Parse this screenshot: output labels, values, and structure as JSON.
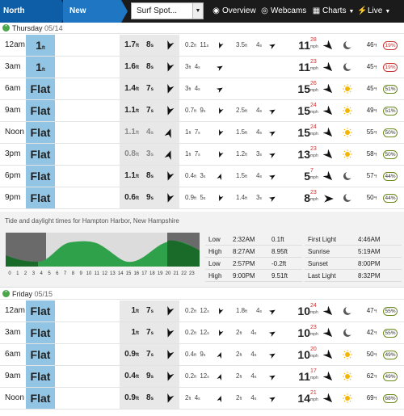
{
  "nav": {
    "region": "North America",
    "subregion": "New England",
    "spot_placeholder": "Surf Spot...",
    "links": [
      {
        "label": "Overview",
        "icon": "globe-icon"
      },
      {
        "label": "Webcams",
        "icon": "webcam-icon"
      },
      {
        "label": "Charts",
        "icon": "grid-icon"
      },
      {
        "label": "Live",
        "icon": "bolt-icon"
      }
    ]
  },
  "days": [
    {
      "name": "Thursday",
      "date": "05/14",
      "rows": [
        {
          "time": "12am",
          "surf": "1",
          "surf_unit": "ft",
          "flat": false,
          "sw1": "1.7",
          "sw1p": "8",
          "sw1dir": 200,
          "sw2": "0.2",
          "sw2p": "11",
          "sw2dir": 200,
          "sw3": "3.5",
          "sw3p": "4",
          "sw3dir": 60,
          "wind": "11",
          "gust": "28",
          "winddir": 135,
          "weather": "moon",
          "temp": "46",
          "tide": "19%",
          "tide_color": "red"
        },
        {
          "time": "3am",
          "surf": "1",
          "surf_unit": "ft",
          "flat": false,
          "sw1": "1.6",
          "sw1p": "8",
          "sw1dir": 200,
          "sw2": "3",
          "sw2p": "4",
          "sw2dir": 60,
          "sw3": "",
          "sw3p": "",
          "sw3dir": null,
          "wind": "11",
          "gust": "23",
          "winddir": 135,
          "weather": "moon",
          "temp": "45",
          "tide": "19%",
          "tide_color": "red"
        },
        {
          "time": "6am",
          "surf": "Flat",
          "surf_unit": "",
          "flat": true,
          "sw1": "1.4",
          "sw1p": "7",
          "sw1dir": 200,
          "sw2": "3",
          "sw2p": "4",
          "sw2dir": 60,
          "sw3": "",
          "sw3p": "",
          "sw3dir": null,
          "wind": "15",
          "gust": "26",
          "winddir": 135,
          "weather": "sun",
          "temp": "45",
          "tide": "51%",
          "tide_color": "green"
        },
        {
          "time": "9am",
          "surf": "Flat",
          "surf_unit": "",
          "flat": true,
          "sw1": "1.1",
          "sw1p": "7",
          "sw1dir": 200,
          "sw2": "0.7",
          "sw2p": "9",
          "sw2dir": 200,
          "sw3": "2.5",
          "sw3p": "4",
          "sw3dir": 60,
          "wind": "15",
          "gust": "24",
          "winddir": 135,
          "weather": "sun",
          "temp": "49",
          "tide": "51%",
          "tide_color": "green"
        },
        {
          "time": "Noon",
          "surf": "Flat",
          "surf_unit": "",
          "flat": true,
          "sw1": "1.1",
          "sw1p": "4",
          "sw1dir": 20,
          "sw2": "1",
          "sw2p": "7",
          "sw2dir": 200,
          "sw3": "1.5",
          "sw3p": "4",
          "sw3dir": 60,
          "wind": "15",
          "gust": "24",
          "winddir": 135,
          "weather": "sun",
          "temp": "55",
          "tide": "50%",
          "tide_color": "green",
          "grey": true
        },
        {
          "time": "3pm",
          "surf": "Flat",
          "surf_unit": "",
          "flat": true,
          "sw1": "0.8",
          "sw1p": "3",
          "sw1dir": 20,
          "sw2": "1",
          "sw2p": "7",
          "sw2dir": 200,
          "sw3": "1.2",
          "sw3p": "3",
          "sw3dir": 60,
          "wind": "13",
          "gust": "23",
          "winddir": 135,
          "weather": "sun",
          "temp": "58",
          "tide": "50%",
          "tide_color": "green",
          "grey": true
        },
        {
          "time": "6pm",
          "surf": "Flat",
          "surf_unit": "",
          "flat": true,
          "sw1": "1.1",
          "sw1p": "8",
          "sw1dir": 200,
          "sw2": "0.4",
          "sw2p": "3",
          "sw2dir": 20,
          "sw3": "1.5",
          "sw3p": "4",
          "sw3dir": 60,
          "wind": "5",
          "gust": "7",
          "winddir": 135,
          "weather": "moon",
          "temp": "57",
          "tide": "44%",
          "tide_color": "green"
        },
        {
          "time": "9pm",
          "surf": "Flat",
          "surf_unit": "",
          "flat": true,
          "sw1": "0.6",
          "sw1p": "9",
          "sw1dir": 200,
          "sw2": "0.9",
          "sw2p": "5",
          "sw2dir": 200,
          "sw3": "1.4",
          "sw3p": "3",
          "sw3dir": 60,
          "wind": "8",
          "gust": "23",
          "winddir": 90,
          "weather": "moon",
          "temp": "50",
          "tide": "44%",
          "tide_color": "green"
        }
      ]
    },
    {
      "name": "Friday",
      "date": "05/15",
      "rows": [
        {
          "time": "12am",
          "surf": "Flat",
          "surf_unit": "",
          "flat": true,
          "sw1": "1",
          "sw1p": "7",
          "sw1dir": 200,
          "sw2": "0.2",
          "sw2p": "12",
          "sw2dir": 200,
          "sw3": "1.8",
          "sw3p": "4",
          "sw3dir": 60,
          "wind": "10",
          "gust": "24",
          "winddir": 135,
          "weather": "moon",
          "temp": "47",
          "tide": "55%",
          "tide_color": "green"
        },
        {
          "time": "3am",
          "surf": "Flat",
          "surf_unit": "",
          "flat": true,
          "sw1": "1",
          "sw1p": "7",
          "sw1dir": 200,
          "sw2": "0.2",
          "sw2p": "12",
          "sw2dir": 200,
          "sw3": "2",
          "sw3p": "4",
          "sw3dir": 60,
          "wind": "10",
          "gust": "23",
          "winddir": 135,
          "weather": "moon",
          "temp": "42",
          "tide": "55%",
          "tide_color": "green"
        },
        {
          "time": "6am",
          "surf": "Flat",
          "surf_unit": "",
          "flat": true,
          "sw1": "0.9",
          "sw1p": "7",
          "sw1dir": 200,
          "sw2": "0.4",
          "sw2p": "9",
          "sw2dir": 20,
          "sw3": "2",
          "sw3p": "4",
          "sw3dir": 60,
          "wind": "10",
          "gust": "20",
          "winddir": 135,
          "weather": "sun",
          "temp": "50",
          "tide": "49%",
          "tide_color": "green"
        },
        {
          "time": "9am",
          "surf": "Flat",
          "surf_unit": "",
          "flat": true,
          "sw1": "0.4",
          "sw1p": "9",
          "sw1dir": 200,
          "sw2": "0.2",
          "sw2p": "12",
          "sw2dir": 20,
          "sw3": "2",
          "sw3p": "4",
          "sw3dir": 60,
          "wind": "11",
          "gust": "17",
          "winddir": 135,
          "weather": "sun",
          "temp": "62",
          "tide": "49%",
          "tide_color": "green"
        },
        {
          "time": "Noon",
          "surf": "Flat",
          "surf_unit": "",
          "flat": true,
          "sw1": "0.9",
          "sw1p": "8",
          "sw1dir": 200,
          "sw2": "2",
          "sw2p": "4",
          "sw2dir": 20,
          "sw3": "2",
          "sw3p": "4",
          "sw3dir": 60,
          "wind": "14",
          "gust": "21",
          "winddir": 135,
          "weather": "sun",
          "temp": "69",
          "tide": "68%",
          "tide_color": "green"
        }
      ]
    }
  ],
  "tides": {
    "title": "Tide and daylight times for Hampton Harbor, New Hampshire",
    "hours": [
      "0",
      "1",
      "2",
      "3",
      "4",
      "5",
      "6",
      "7",
      "8",
      "9",
      "10",
      "11",
      "12",
      "13",
      "14",
      "15",
      "16",
      "17",
      "18",
      "19",
      "20",
      "21",
      "22",
      "23"
    ],
    "table": [
      {
        "type": "Low",
        "time": "2:32AM",
        "height": "0.1ft"
      },
      {
        "type": "High",
        "time": "8:27AM",
        "height": "8.95ft"
      },
      {
        "type": "Low",
        "time": "2:57PM",
        "height": "-0.2ft"
      },
      {
        "type": "High",
        "time": "9:00PM",
        "height": "9.51ft"
      }
    ],
    "sun": [
      {
        "label": "First Light",
        "time": "4:46AM"
      },
      {
        "label": "Sunrise",
        "time": "5:19AM"
      },
      {
        "label": "Sunset",
        "time": "8:00PM"
      },
      {
        "label": "Last Light",
        "time": "8:32PM"
      }
    ]
  },
  "units": {
    "ft": "ft",
    "s": "s",
    "mph": "mph",
    "deg": "°f"
  }
}
